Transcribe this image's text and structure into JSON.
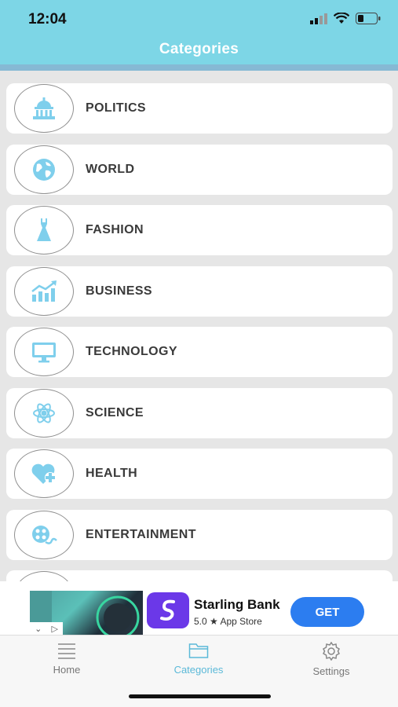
{
  "status_bar": {
    "time": "12:04"
  },
  "header": {
    "title": "Categories"
  },
  "categories": [
    {
      "label": "POLITICS",
      "icon": "capitol-icon"
    },
    {
      "label": "WORLD",
      "icon": "globe-icon"
    },
    {
      "label": "FASHION",
      "icon": "dress-icon"
    },
    {
      "label": "BUSINESS",
      "icon": "chart-growth-icon"
    },
    {
      "label": "TECHNOLOGY",
      "icon": "monitor-icon"
    },
    {
      "label": "SCIENCE",
      "icon": "atom-icon"
    },
    {
      "label": "HEALTH",
      "icon": "heart-plus-icon"
    },
    {
      "label": "ENTERTAINMENT",
      "icon": "film-reel-icon"
    }
  ],
  "ad": {
    "app_name": "Starling Bank",
    "rating": "5.0 ★ App Store",
    "button_label": "GET"
  },
  "tabs": [
    {
      "label": "Home",
      "icon": "list-icon",
      "active": false
    },
    {
      "label": "Categories",
      "icon": "folder-icon",
      "active": true
    },
    {
      "label": "Settings",
      "icon": "gear-icon",
      "active": false
    }
  ],
  "colors": {
    "header": "#7dd6e6",
    "icon_accent": "#7fcfec",
    "active_tab": "#5bb9d8",
    "ad_button": "#2c7df0"
  }
}
